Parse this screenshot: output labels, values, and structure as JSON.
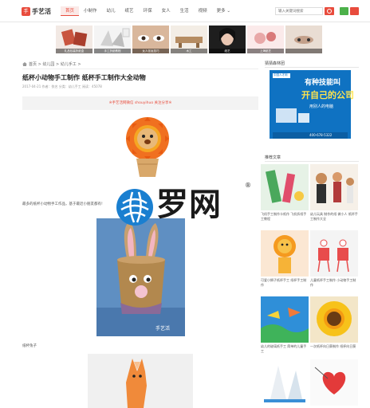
{
  "header": {
    "logo_mark": "手",
    "logo_text": "手艺活",
    "nav": [
      "首页",
      "小制作",
      "幼儿",
      "纸艺",
      "环保",
      "女人",
      "生活",
      "视频",
      "更多"
    ],
    "search_placeholder": "输入关键词搜索"
  },
  "strip": [
    {
      "caption": "礼品包装折纸盒",
      "color": "#c9553f"
    },
    {
      "caption": "手工折纸教程",
      "color": "#d8d8d8"
    },
    {
      "caption": "女人化妆技巧",
      "color": "#d9b79c"
    },
    {
      "caption": "木工",
      "color": "#b58c62"
    },
    {
      "caption": "纸艺",
      "color": "#2a2a2a"
    },
    {
      "caption": "上海纸艺",
      "color": "#e8a8a8"
    },
    {
      "caption": "",
      "color": "#c3a08a"
    }
  ],
  "breadcrumb": "首页 > 幼儿园 > 幼儿手工 >",
  "article": {
    "title": "纸杯小动物手工制作 纸杯手工制作大全动物",
    "meta": "2017-04-21  作者：佚名  分类：幼儿手工  阅读：45078",
    "notice": "※手艺活网微信 shouyihuo 关注分享※",
    "para1": "最多的纸杯小动物手工作品，基于最近小朋友都有!",
    "para2": "纸杯兔子"
  },
  "watermark": {
    "text": "罗网",
    "reg": "®"
  },
  "sidebar": {
    "ad_heading": "猜猜森林团",
    "ad": {
      "slogan": "有种技能叫",
      "big": "开自己的公司",
      "sub": "用别人的电脑",
      "brand": "中国人才网",
      "phone": "400-678-5322"
    },
    "articles_heading": "推荐文章",
    "articles": [
      "飞机手工制作卡纸作 飞机折纸手工教程",
      "幼儿玩具 制作的纸 做小人 纸杯手工制作大全",
      "可爱小狮子纸杯手工 纸杯手工制作",
      "儿童纸杯手工制作 小动物手工制作",
      "幼儿的玻璃纸手工 简单的儿童手工",
      "一次纸杯向日葵制作 纸杯向日葵",
      "",
      ""
    ]
  },
  "colors": {
    "accent": "#e84c3d",
    "wechat": "#4cb14a",
    "ad_blue": "#0f72c2"
  }
}
